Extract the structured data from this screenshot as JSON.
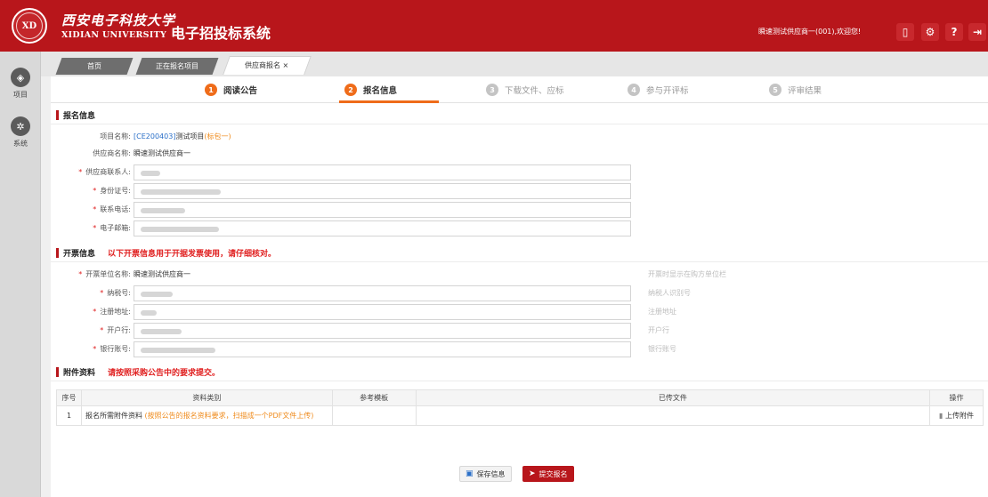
{
  "header": {
    "university_cn": "西安电子科技大学",
    "university_en": "XIDIAN UNIVERSITY",
    "emblem_text": "XD",
    "system_title": "电子招投标系统",
    "welcome": "瞬速测试供应商一(001),欢迎您!",
    "buttons": {
      "phone_icon": "▯",
      "settings_icon": "⚙",
      "help_icon": "?",
      "logout_icon": "⇥"
    }
  },
  "sidebar": {
    "items": [
      {
        "label": "项目",
        "icon": "◈"
      },
      {
        "label": "系统",
        "icon": "✲"
      }
    ]
  },
  "tabs": [
    {
      "label": "首页"
    },
    {
      "label": "正在报名项目"
    },
    {
      "label": "供应商报名 ×"
    }
  ],
  "steps": [
    {
      "num": "1",
      "label": "阅读公告"
    },
    {
      "num": "2",
      "label": "报名信息"
    },
    {
      "num": "3",
      "label": "下载文件、应标"
    },
    {
      "num": "4",
      "label": "参与开评标"
    },
    {
      "num": "5",
      "label": "评审结果"
    }
  ],
  "registration": {
    "title": "报名信息",
    "project_label": "项目名称:",
    "project_code": "[CE200403]",
    "project_name": "测试项目",
    "project_lot": "(标包一)",
    "supplier_label": "供应商名称:",
    "supplier_value": "瞬速测试供应商一",
    "contact_label": "供应商联系人:",
    "id_label": "身份证号:",
    "phone_label": "联系电话:",
    "email_label": "电子邮箱:"
  },
  "invoice": {
    "title": "开票信息",
    "note": "以下开票信息用于开据发票使用，请仔细核对。",
    "company_label": "开票单位名称:",
    "company_value": "瞬速测试供应商一",
    "company_hint": "开票时显示在购方单位栏",
    "tax_label": "纳税号:",
    "tax_hint": "纳税人识别号",
    "address_label": "注册地址:",
    "address_hint": "注册地址",
    "bank_label": "开户行:",
    "bank_hint": "开户行",
    "account_label": "银行账号:",
    "account_hint": "银行账号"
  },
  "attachments": {
    "title": "附件资料",
    "note": "请按照采购公告中的要求提交。",
    "columns": [
      "序号",
      "资料类别",
      "参考模板",
      "已传文件",
      "操作"
    ],
    "rows": [
      {
        "no": "1",
        "category": "报名所需附件资料",
        "category_note": "(按照公告的报名资料要求，扫描成一个PDF文件上传)",
        "template": "",
        "uploaded": "",
        "action": "上传附件"
      }
    ]
  },
  "actions": {
    "save": "保存信息",
    "submit": "提交报名"
  },
  "colors": {
    "brand": "#b8161b",
    "step_active": "#ef6c1a",
    "required": "#e02020"
  }
}
